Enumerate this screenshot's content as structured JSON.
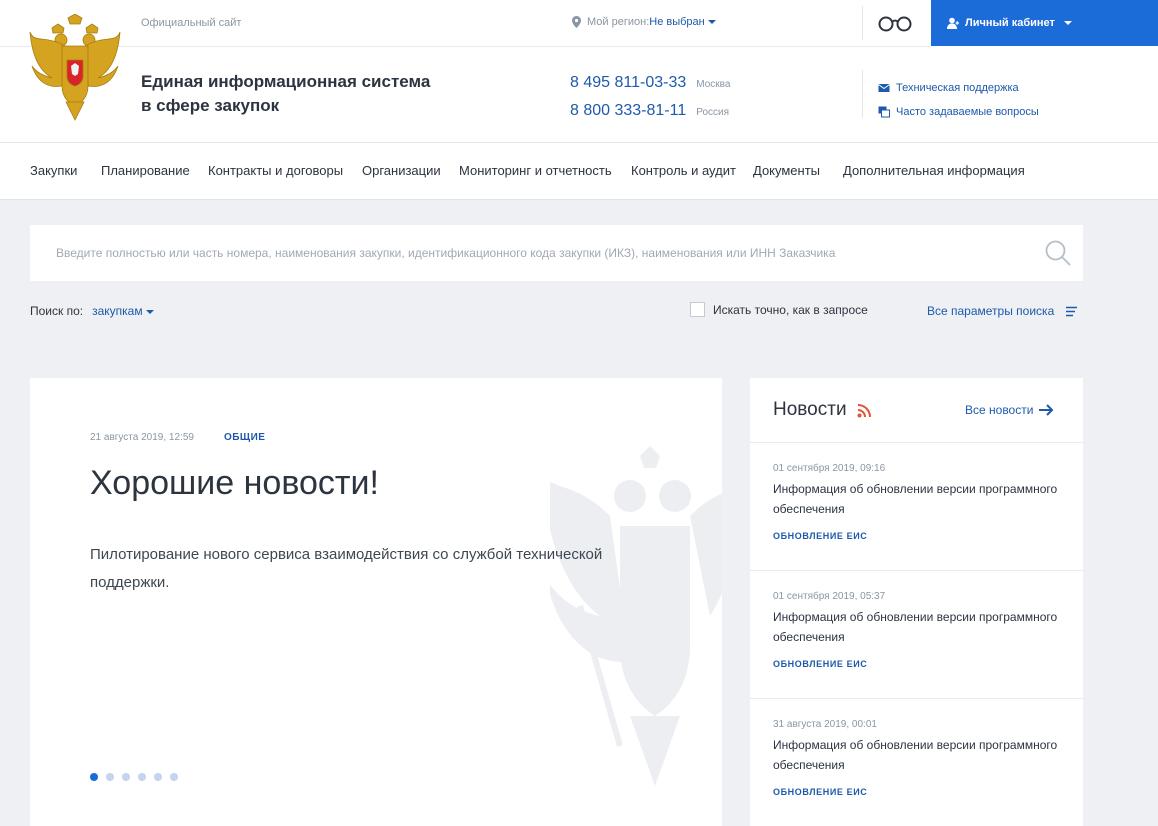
{
  "header": {
    "official_label": "Официальный сайт",
    "site_name_line1": "Единая информационная система",
    "site_name_line2": "в сфере закупок",
    "region_label": "Мой регион:",
    "region_value": "Не выбран",
    "cabinet_label": "Личный кабинет",
    "phones": [
      {
        "number": "8 495 811-03-33",
        "city": "Москва"
      },
      {
        "number": "8 800 333-81-11",
        "city": "Россия"
      }
    ],
    "support_links": [
      {
        "label": "Техническая поддержка",
        "icon": "mail-icon"
      },
      {
        "label": "Часто задаваемые вопросы",
        "icon": "faq-icon"
      }
    ],
    "accessibility_icon": "glasses-icon"
  },
  "nav": {
    "items": [
      "Закупки",
      "Планирование",
      "Контракты и договоры",
      "Организации",
      "Мониторинг и отчетность",
      "Контроль и аудит",
      "Документы",
      "Дополнительная информация"
    ]
  },
  "search": {
    "placeholder": "Введите полностью или часть номера, наименования закупки, идентификационного кода закупки (ИКЗ), наименования или ИНН Заказчика",
    "search_by_label": "Поиск по:",
    "search_by_value": "закупкам",
    "exact_label": "Искать точно, как в запросе",
    "all_params_label": "Все параметры поиска"
  },
  "featured": {
    "date": "21 августа 2019, 12:59",
    "category": "ОБЩИЕ",
    "title": "Хорошие новости!",
    "text": "Пилотирование нового сервиса взаимодействия со службой технической поддержки.",
    "slides_count": 6,
    "active_slide": 1
  },
  "news": {
    "title": "Новости",
    "all_label": "Все новости",
    "items": [
      {
        "date": "01 сентября 2019, 09:16",
        "title": "Информация об обновлении версии программного обеспечения",
        "category": "ОБНОВЛЕНИЕ ЕИС"
      },
      {
        "date": "01 сентября 2019, 05:37",
        "title": "Информация об обновлении версии программного обеспечения",
        "category": "ОБНОВЛЕНИЕ ЕИС"
      },
      {
        "date": "31 августа 2019, 00:01",
        "title": "Информация об обновлении версии программного обеспечения",
        "category": "ОБНОВЛЕНИЕ ЕИС"
      }
    ]
  },
  "colors": {
    "accent": "#1b6bd8",
    "link": "#1d5aab",
    "rss": "#e2523a",
    "background": "#eef0f3"
  }
}
